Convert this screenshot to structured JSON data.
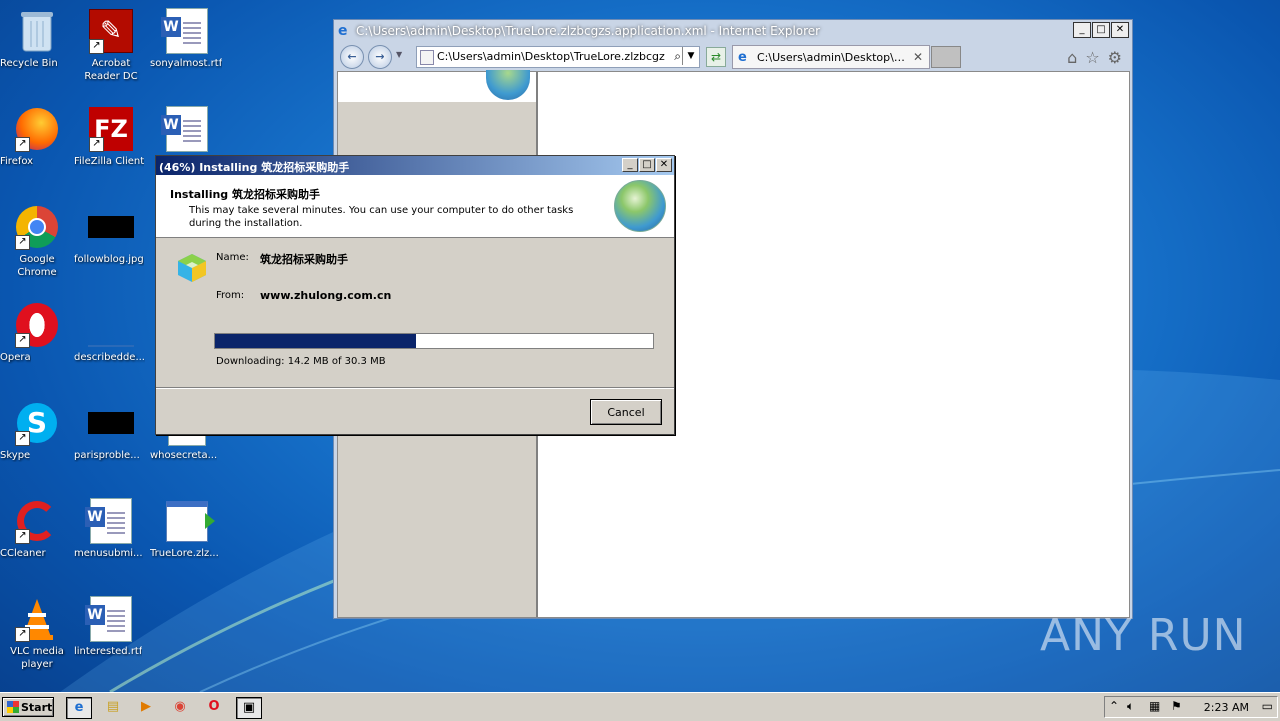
{
  "desktop": {
    "icons": [
      {
        "label": "Recycle Bin"
      },
      {
        "label": "Acrobat Reader DC"
      },
      {
        "label": "sonyalmost.rtf"
      },
      {
        "label": "Firefox"
      },
      {
        "label": "FileZilla Client"
      },
      {
        "label": "Google Chrome"
      },
      {
        "label": "followblog.jpg"
      },
      {
        "label": "Opera"
      },
      {
        "label": "describedde..."
      },
      {
        "label": "Skype"
      },
      {
        "label": "parisproble..."
      },
      {
        "label": "whosecreta..."
      },
      {
        "label": "CCleaner"
      },
      {
        "label": "menusubmi..."
      },
      {
        "label": "TrueLore.zlz..."
      },
      {
        "label": "VLC media player"
      },
      {
        "label": "linterested.rtf"
      }
    ],
    "watermark": "ANY RUN"
  },
  "ie": {
    "title": "C:\\Users\\admin\\Desktop\\TrueLore.zlzbcgzs.application.xml - Internet Explorer",
    "address": "C:\\Users\\admin\\Desktop\\TrueLore.zlzbcgzs.application.xml",
    "tab_label": "C:\\Users\\admin\\Desktop\\TrueLore.zlzbcgzs...",
    "back_glyph": "←",
    "forward_glyph": "→"
  },
  "dialog": {
    "title": "(46%) Installing 筑龙招标采购助手",
    "heading": "Installing 筑龙招标采购助手",
    "subtext": "This may take several minutes. You can use your computer to do other tasks during the installation.",
    "name_label": "Name:",
    "name_value": "筑龙招标采购助手",
    "from_label": "From:",
    "from_value": "www.zhulong.com.cn",
    "progress_fraction": 0.46,
    "status": "Downloading: 14.2 MB of 30.3 MB",
    "cancel_label": "Cancel"
  },
  "taskbar": {
    "start_label": "Start",
    "clock": "2:23 AM"
  },
  "colors": {
    "titlebar": "#0a246a",
    "progress": "#0a246a",
    "desktop": "#1a78d0"
  }
}
